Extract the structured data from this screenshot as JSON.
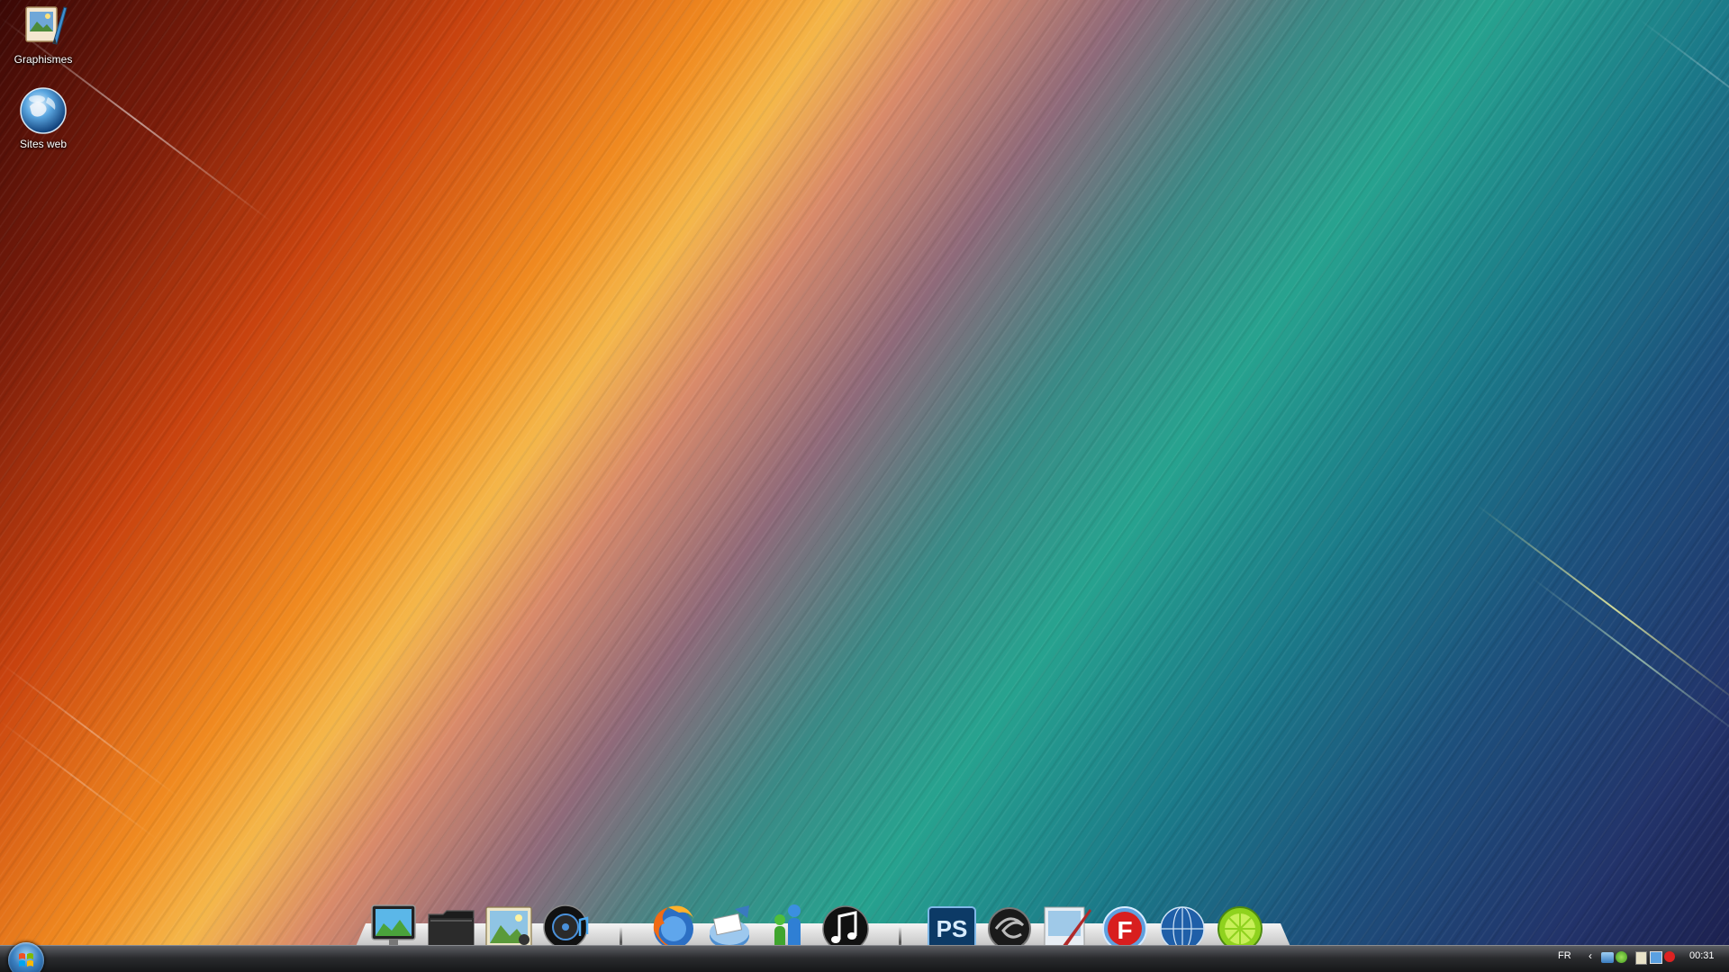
{
  "desktop": {
    "icons": [
      {
        "label": "Graphismes",
        "icon": "graphics-folder-icon"
      },
      {
        "label": "Sites web",
        "icon": "globe-icon"
      }
    ]
  },
  "dock": {
    "groups": [
      [
        {
          "icon": "computer-monitor-icon"
        },
        {
          "icon": "black-folder-icon"
        },
        {
          "icon": "photo-gallery-icon"
        },
        {
          "icon": "music-player-icon"
        }
      ],
      [
        {
          "icon": "firefox-browser-icon"
        },
        {
          "icon": "mail-client-icon"
        },
        {
          "icon": "messenger-icon"
        },
        {
          "icon": "itunes-icon"
        }
      ],
      [
        {
          "icon": "photoshop-icon"
        },
        {
          "icon": "dreamweaver-icon"
        },
        {
          "icon": "paint-icon"
        },
        {
          "icon": "flash-icon"
        },
        {
          "icon": "web-globe-icon"
        },
        {
          "icon": "limewire-icon"
        }
      ]
    ]
  },
  "taskbar": {
    "start_icon": "windows-start-orb-icon",
    "language": "FR",
    "tray_icons": [
      "show-hidden-icons-chevron-icon",
      "network-users-icon",
      "messenger-tray-icon",
      "clipboard-icon",
      "network-icon",
      "volume-muted-icon"
    ],
    "clock": "00:31"
  }
}
